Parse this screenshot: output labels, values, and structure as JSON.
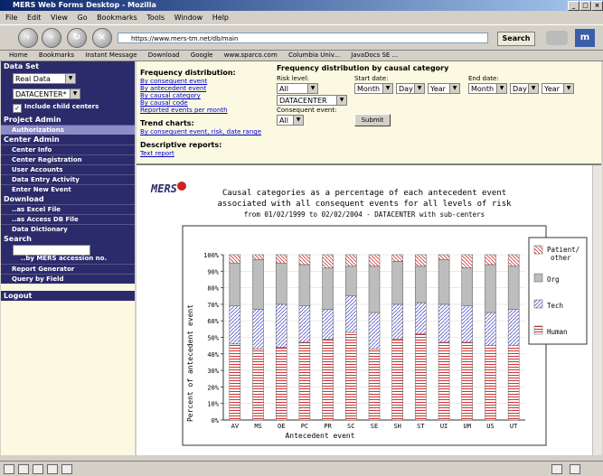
{
  "window": {
    "title": "MERS Web Forms Desktop - Mozilla"
  },
  "menu": [
    "File",
    "Edit",
    "View",
    "Go",
    "Bookmarks",
    "Tools",
    "Window",
    "Help"
  ],
  "nav": {
    "url": "https://www.mers-tm.net/db/main",
    "search_label": "Search"
  },
  "bookmarks": [
    "Home",
    "Bookmarks",
    "Instant Message",
    "Download",
    "Google",
    "www.sparco.com",
    "Columbia Univ...",
    "JavaDocs SE ..."
  ],
  "sidebar": {
    "dataset_header": "Data Set",
    "dataset_value": "Real Data",
    "center_value": "DATACENTER*",
    "include_children": "Include child centers",
    "project_admin": "Project Admin",
    "authorizations": "Authorizations",
    "center_admin": "Center Admin",
    "center_items": [
      "Center Info",
      "Center Registration",
      "User Accounts",
      "Data Entry Activity",
      "Enter New Event"
    ],
    "download": "Download",
    "download_items": [
      "..as Excel File",
      "..as Access DB File",
      "Data Dictionary"
    ],
    "search": "Search",
    "search_hint": "..by MERS accession no.",
    "search_items": [
      "Report Generator",
      "Query by Field"
    ],
    "logout": "Logout"
  },
  "filters": {
    "freq_heading": "Frequency distribution:",
    "freq_links": [
      "By consequent event",
      "By antecedent event",
      "By causal category",
      "By causal code",
      "Reported events per month"
    ],
    "trend_heading": "Trend charts:",
    "trend_link": "By consequent event, risk, date range",
    "desc_heading": "Descriptive reports:",
    "desc_link": "Text report",
    "causal_heading": "Frequency distribution by causal category",
    "risk_label": "Risk level:",
    "risk_value": "All",
    "center_value": "DATACENTER",
    "consequent_label": "Consequent event:",
    "consequent_value": "All",
    "start_label": "Start date:",
    "end_label": "End date:",
    "month": "Month",
    "day": "Day",
    "year": "Year",
    "submit_label": "Submit"
  },
  "logo": "MERS",
  "chart_data": {
    "type": "bar",
    "stacked": true,
    "title": "Causal categories as a percentage of each antecedent event associated with all consequent events for all levels of risk",
    "title_lines": [
      "Causal categories as a percentage of each antecedent event",
      "associated with all consequent events for all levels of risk"
    ],
    "subtitle": "from 01/02/1999 to 02/02/2004 - DATACENTER with sub-centers",
    "xlabel": "Antecedent event",
    "ylabel": "Percent of antecedent event",
    "ylim": [
      0,
      100
    ],
    "yticks": [
      "0%",
      "10%",
      "20%",
      "30%",
      "40%",
      "50%",
      "60%",
      "70%",
      "80%",
      "90%",
      "100%"
    ],
    "categories": [
      "AV",
      "MS",
      "OE",
      "PC",
      "PR",
      "SC",
      "SE",
      "SH",
      "ST",
      "UI",
      "UM",
      "US",
      "UT"
    ],
    "legend_position": "right",
    "series": [
      {
        "name": "Human",
        "color": "#cc3333",
        "values": [
          46,
          43,
          44,
          47,
          49,
          53,
          43,
          49,
          52,
          47,
          47,
          45,
          45
        ]
      },
      {
        "name": "Tech",
        "color": "#5555cc",
        "values": [
          23,
          24,
          26,
          22,
          18,
          22,
          22,
          21,
          19,
          23,
          22,
          20,
          22
        ]
      },
      {
        "name": "Org",
        "color": "#999999",
        "values": [
          26,
          30,
          25,
          25,
          25,
          18,
          28,
          26,
          22,
          27,
          23,
          29,
          26
        ]
      },
      {
        "name": "Patient/other",
        "color": "#cc3333",
        "values": [
          5,
          3,
          5,
          6,
          8,
          7,
          7,
          4,
          7,
          3,
          8,
          6,
          7
        ]
      }
    ]
  },
  "colors": {
    "nav_dark": "#2b2b6b",
    "panel_bg": "#fbf9e1"
  }
}
